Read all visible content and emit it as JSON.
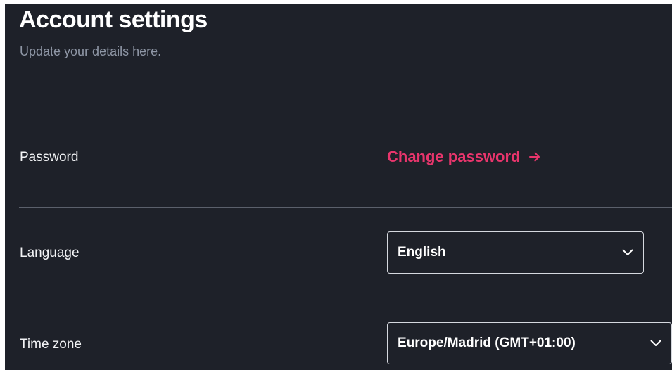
{
  "header": {
    "title": "Account settings",
    "subtitle": "Update your details here."
  },
  "password": {
    "label": "Password",
    "link_label": "Change password",
    "link_icon": "arrow-right-icon"
  },
  "language": {
    "label": "Language",
    "selected": "English",
    "icon": "chevron-down-icon"
  },
  "timezone": {
    "label": "Time zone",
    "selected": "Europe/Madrid (GMT+01:00)",
    "icon": "chevron-down-icon"
  },
  "colors": {
    "background": "#1e2129",
    "accent": "#e8356c",
    "subtitle": "#8f97a6",
    "divider": "#5b606b"
  }
}
